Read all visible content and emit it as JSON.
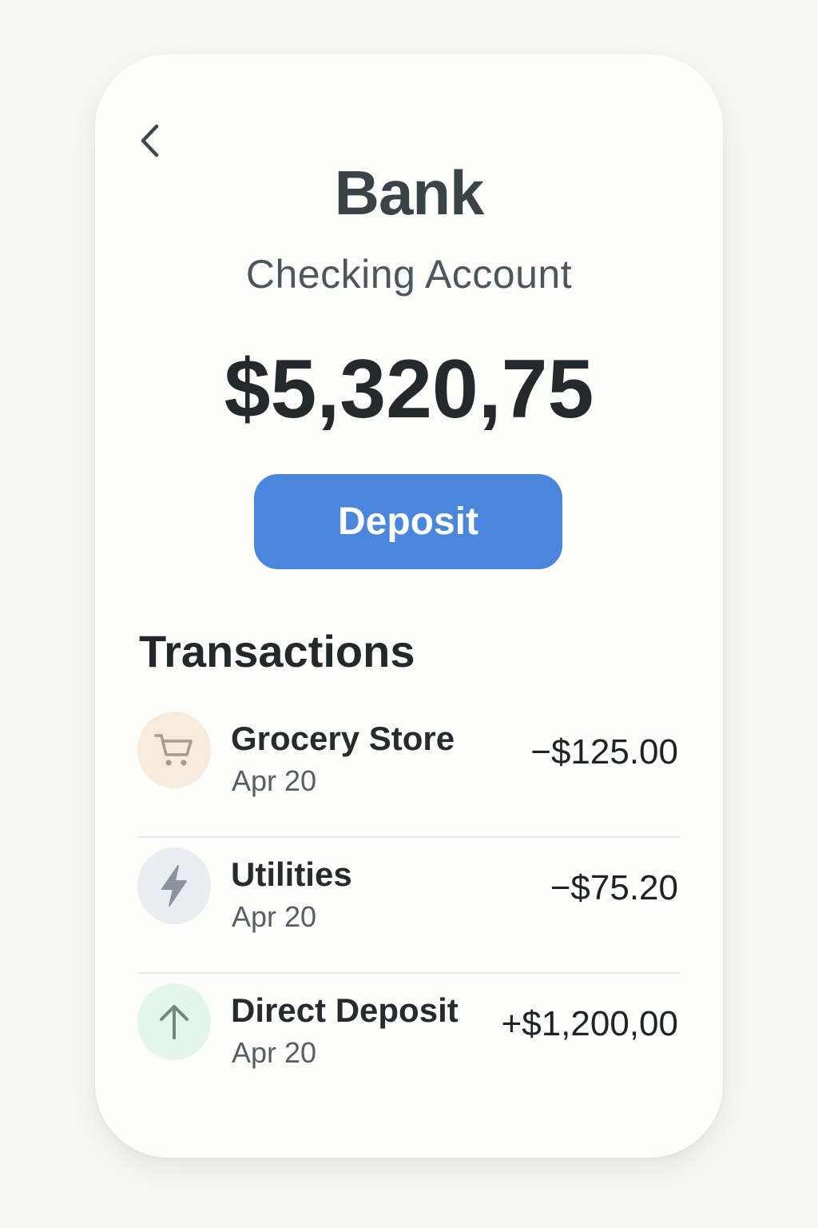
{
  "header": {
    "bank_name": "Bank",
    "account_name": "Checking Account"
  },
  "balance": "$5,320,75",
  "actions": {
    "deposit_label": "Deposit"
  },
  "transactions": {
    "title": "Transactions",
    "items": [
      {
        "name": "Grocery Store",
        "date": "Apr 20",
        "amount": "−$125.00",
        "icon": "cart-icon",
        "icon_bg": "#f6ebdc",
        "icon_color": "#a99b89"
      },
      {
        "name": "Utilities",
        "date": "Apr 20",
        "amount": "−$75.20",
        "icon": "lightning-icon",
        "icon_bg": "#e9edf1",
        "icon_color": "#8a949c"
      },
      {
        "name": "Direct Deposit",
        "date": "Apr 20",
        "amount": "+$1,200,00",
        "icon": "arrow-up-icon",
        "icon_bg": "#e3f5ec",
        "icon_color": "#6f8a7c"
      }
    ]
  },
  "colors": {
    "accent": "#4a87dc",
    "text_primary": "#24292c",
    "text_secondary": "#575f63",
    "card_background": "#fdfdfc",
    "page_background": "#f7f7f5",
    "divider": "#e6e8e9"
  }
}
